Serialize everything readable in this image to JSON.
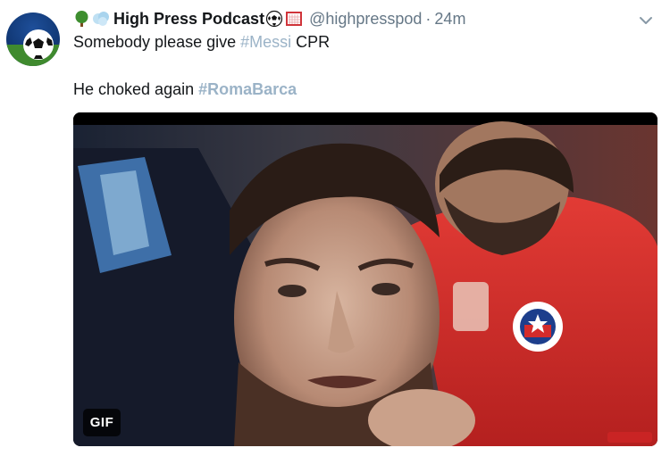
{
  "tweet": {
    "display_name": "High Press Podcast",
    "handle": "@highpresspod",
    "separator": "·",
    "time": "24m",
    "line1_text": "Somebody please give ",
    "line1_hashtag": "#Messi",
    "line1_tail": " CPR",
    "line2_text": "He choked again ",
    "line2_hashtag": "#RomaBarca"
  },
  "media": {
    "badge": "GIF"
  },
  "icons": {
    "name_emojis": [
      "tree-emoji",
      "wind-emoji",
      "soccer-ball-emoji",
      "goal-net-emoji"
    ],
    "menu": "chevron-down-icon"
  },
  "colors": {
    "text": "#14171a",
    "secondary": "#657786",
    "hashtag": "#9bb3c7",
    "jersey_red": "#d42b2b"
  }
}
